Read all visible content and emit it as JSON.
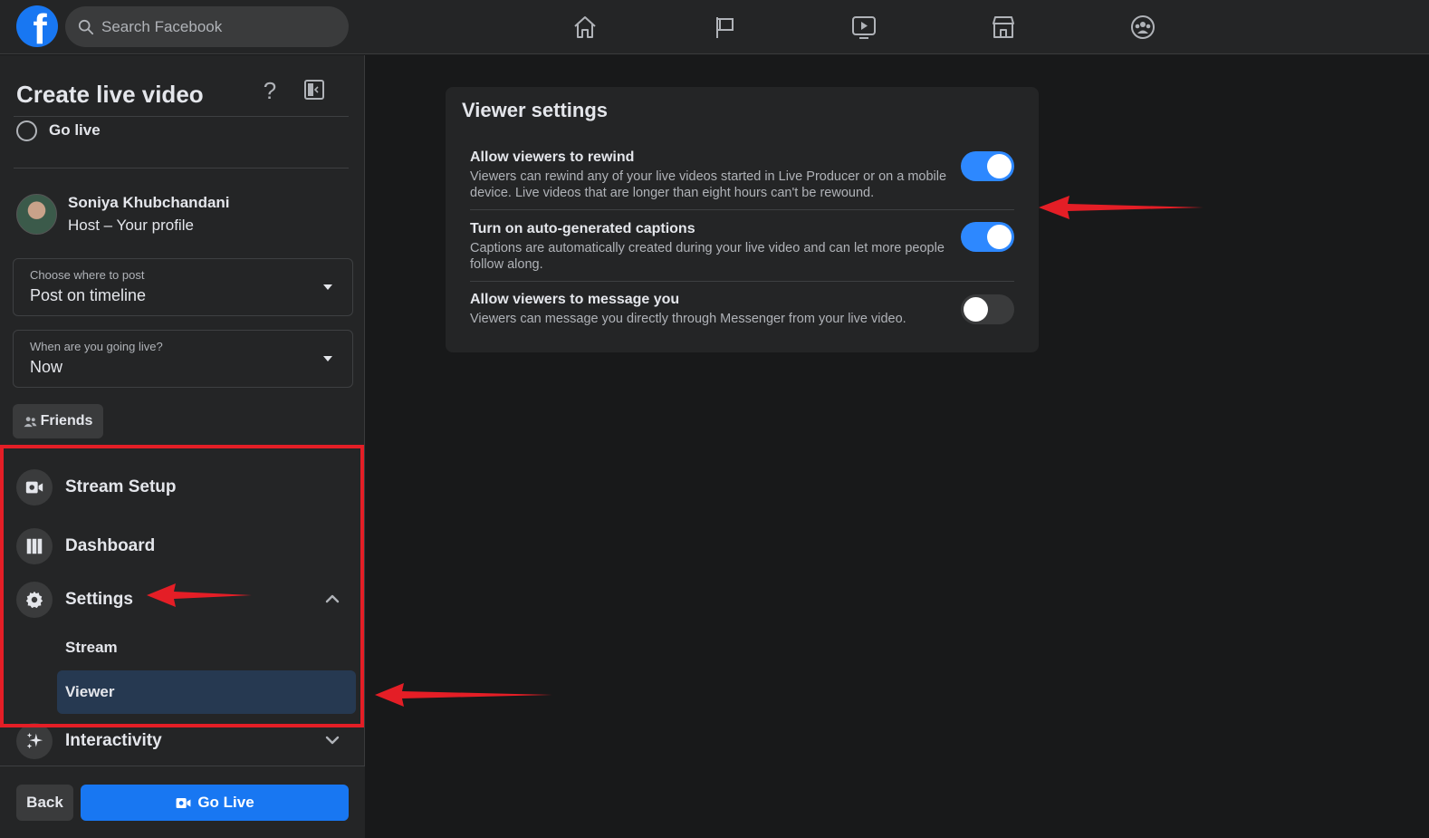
{
  "topbar": {
    "logo_letter": "f",
    "search_placeholder": "Search Facebook",
    "nav_icons": [
      "home-icon",
      "flag-icon",
      "watch-icon",
      "marketplace-icon",
      "groups-icon"
    ]
  },
  "left_panel": {
    "title": "Create live video",
    "help_symbol": "?",
    "go_live_option": "Go live",
    "host": {
      "name": "Soniya Khubchandani",
      "role": "Host – Your profile"
    },
    "post_where": {
      "label": "Choose where to post",
      "value": "Post on timeline"
    },
    "when_live": {
      "label": "When are you going live?",
      "value": "Now"
    },
    "audience_button": "Friends",
    "menu": {
      "stream_setup": "Stream Setup",
      "dashboard": "Dashboard",
      "settings": "Settings",
      "settings_sub": {
        "stream": "Stream",
        "viewer": "Viewer"
      },
      "interactivity": "Interactivity"
    },
    "footer": {
      "back": "Back",
      "go_live": "Go Live"
    }
  },
  "viewer_settings": {
    "title": "Viewer settings",
    "items": [
      {
        "title": "Allow viewers to rewind",
        "description": "Viewers can rewind any of your live videos started in Live Producer or on a mobile device. Live videos that are longer than eight hours can't be rewound.",
        "enabled": true
      },
      {
        "title": "Turn on auto-generated captions",
        "description": "Captions are automatically created during your live video and can let more people follow along.",
        "enabled": true
      },
      {
        "title": "Allow viewers to message you",
        "description": "Viewers can message you directly through Messenger from your live video.",
        "enabled": false
      }
    ]
  },
  "colors": {
    "accent": "#1877f2",
    "toggle_on": "#2d88ff",
    "annotation": "#e41e26",
    "active_item": "#263951"
  }
}
